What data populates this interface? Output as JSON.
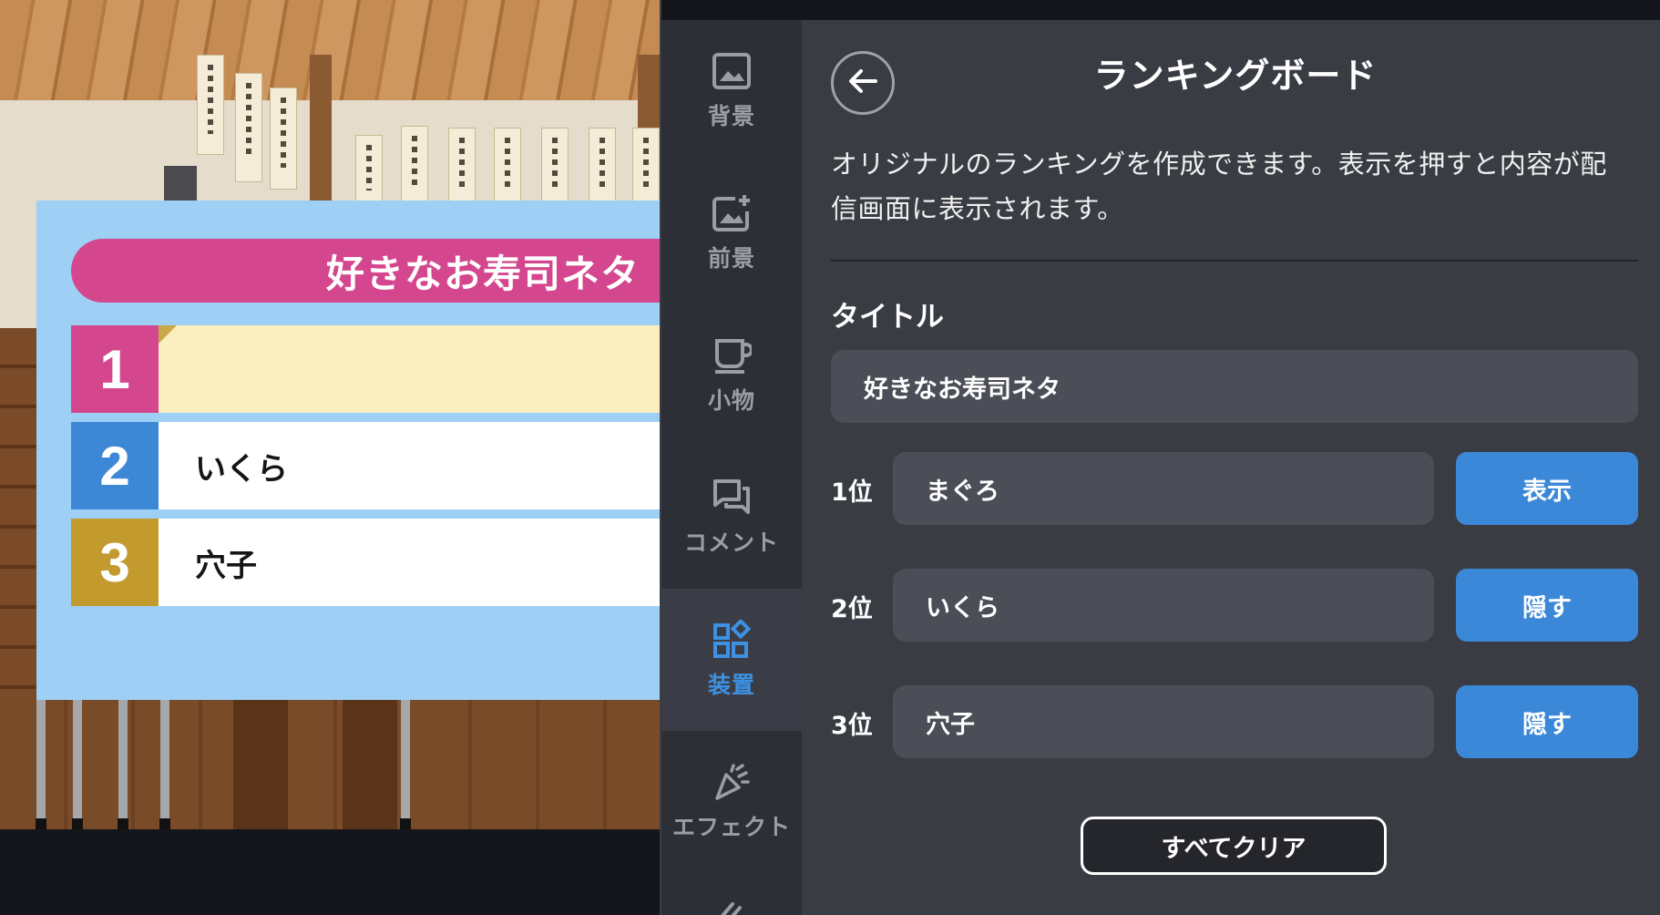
{
  "preview": {
    "board_title": "好きなお寿司ネタ",
    "rows": [
      {
        "rank": "1",
        "name": "",
        "rank_color": "#d4478e",
        "cell_color": "#fbeebf"
      },
      {
        "rank": "2",
        "name": "いくら",
        "rank_color": "#3d88d6",
        "cell_color": "#ffffff"
      },
      {
        "rank": "3",
        "name": "穴子",
        "rank_color": "#c39a2e",
        "cell_color": "#ffffff"
      }
    ]
  },
  "sidenav": {
    "items": [
      {
        "label": "背景",
        "icon": "image-icon",
        "active": false
      },
      {
        "label": "前景",
        "icon": "add-image-icon",
        "active": false
      },
      {
        "label": "小物",
        "icon": "cup-icon",
        "active": false
      },
      {
        "label": "コメント",
        "icon": "chat-icon",
        "active": false
      },
      {
        "label": "装置",
        "icon": "widgets-icon",
        "active": true
      },
      {
        "label": "エフェクト",
        "icon": "party-popper-icon",
        "active": false
      }
    ]
  },
  "panel": {
    "title": "ランキングボード",
    "description": "オリジナルのランキングを作成できます。表示を押すと内容が配信画面に表示されます。",
    "title_field_label": "タイトル",
    "title_value": "好きなお寿司ネタ",
    "ranks": [
      {
        "label": "1位",
        "value": "まぐろ",
        "button": "表示"
      },
      {
        "label": "2位",
        "value": "いくら",
        "button": "隠す"
      },
      {
        "label": "3位",
        "value": "穴子",
        "button": "隠す"
      }
    ],
    "clear_button": "すべてクリア"
  },
  "colors": {
    "accent": "#3b88d8",
    "panel_bg": "#393c43",
    "input_bg": "#4b4e57",
    "nav_bg": "#2c2f36"
  }
}
